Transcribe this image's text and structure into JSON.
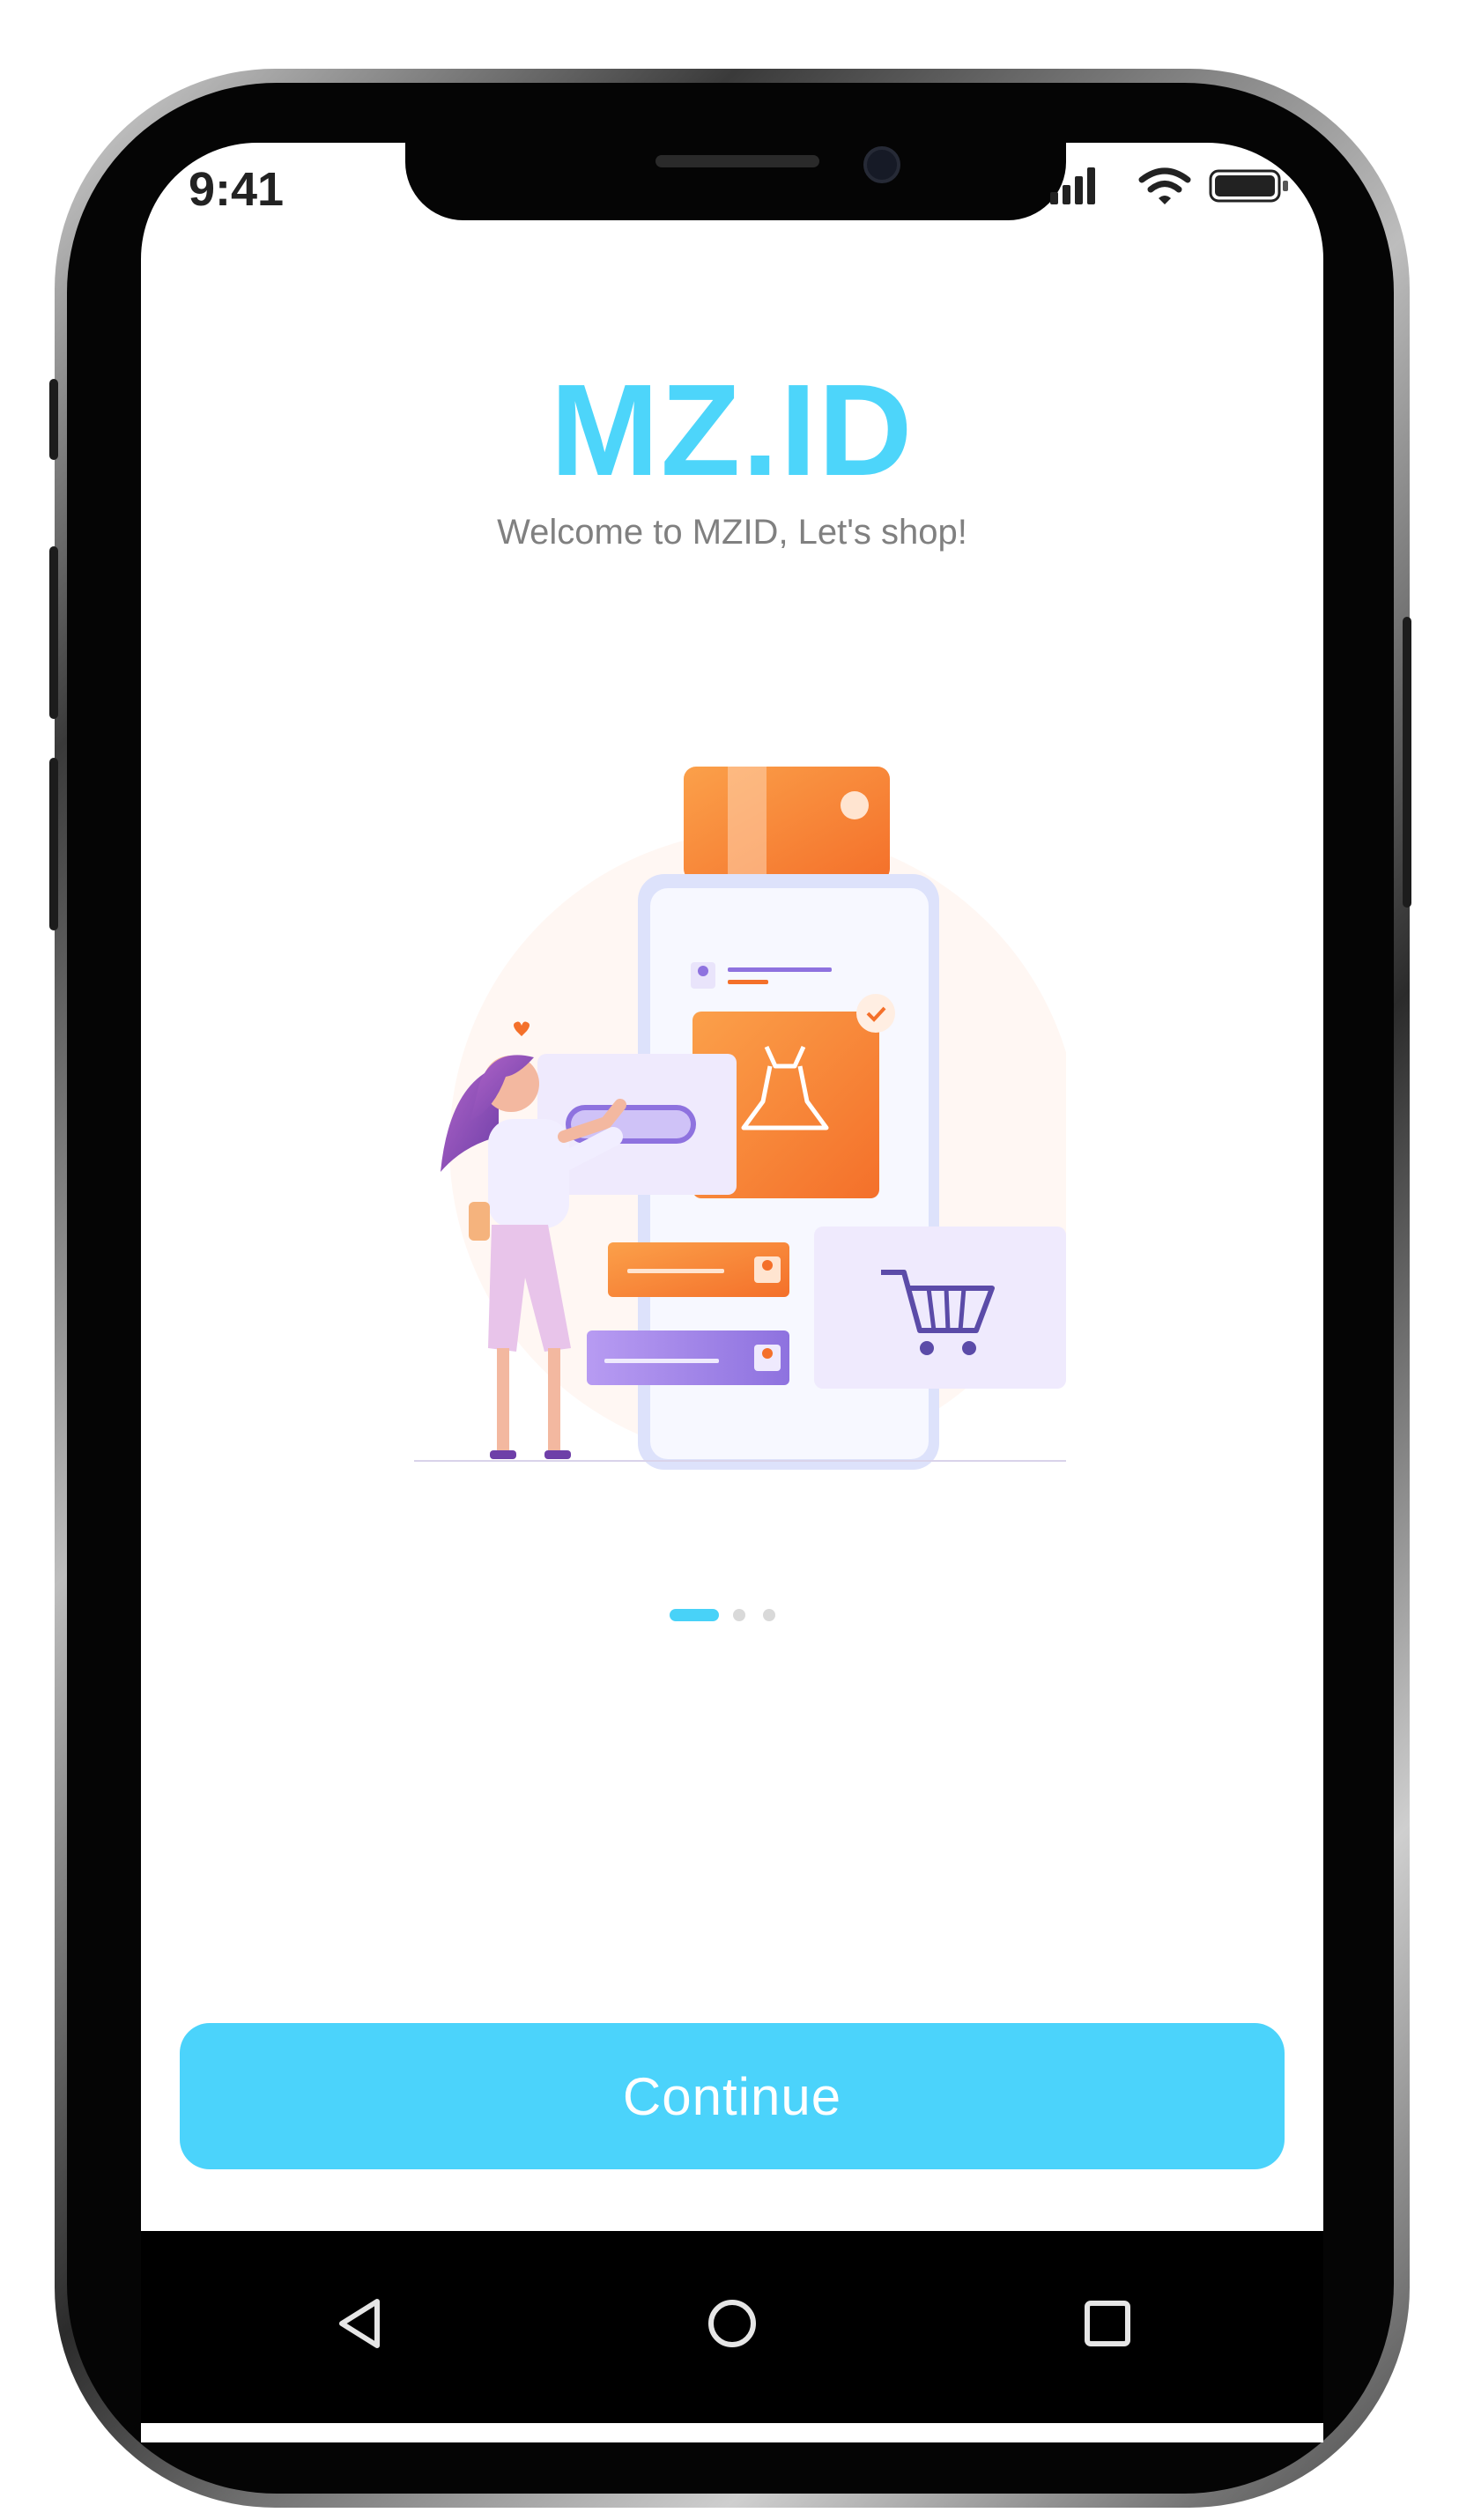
{
  "status_bar": {
    "time": "9:41",
    "icons": [
      "signal-icon",
      "wifi-icon",
      "battery-icon"
    ]
  },
  "app": {
    "title": "MZ.ID",
    "tagline": "Welcome to MZID, Let's shop!"
  },
  "pager": {
    "total": 3,
    "active_index": 0
  },
  "actions": {
    "continue_label": "Continue"
  },
  "navigation_bar": {
    "buttons": [
      "back-icon",
      "home-icon",
      "recents-icon"
    ]
  },
  "colors": {
    "accent": "#4BD3FB",
    "title": "#4DD5FA",
    "illustration_orange": "#F7882E",
    "illustration_purple": "#A588E8"
  }
}
